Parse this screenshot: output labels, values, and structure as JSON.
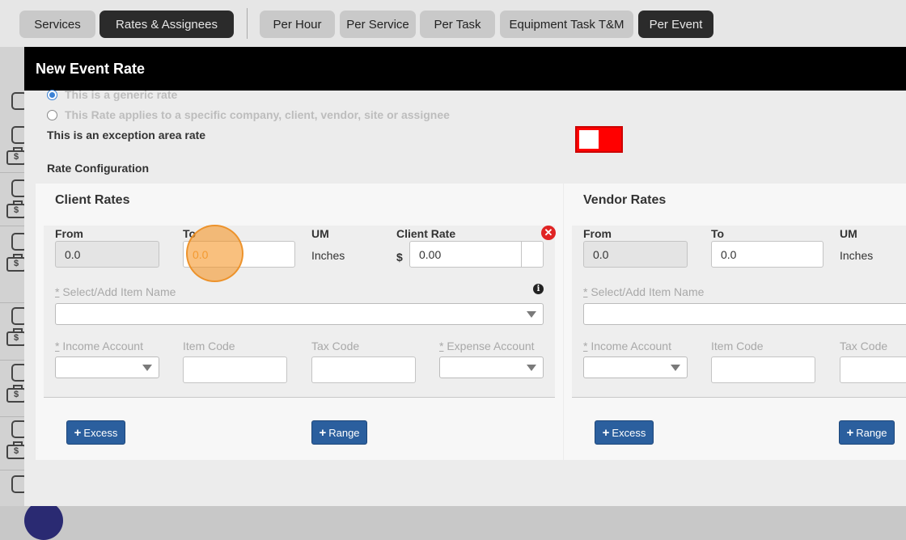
{
  "tabs": [
    {
      "label": "Services",
      "active": false
    },
    {
      "label": "Rates & Assignees",
      "active": true
    },
    {
      "label": "Per Hour",
      "active": false
    },
    {
      "label": "Per Service",
      "active": false
    },
    {
      "label": "Per Task",
      "active": false
    },
    {
      "label": "Equipment Task T&M",
      "active": false
    },
    {
      "label": "Per Event",
      "active": true
    }
  ],
  "modal": {
    "title": "New Event Rate",
    "generic_rate_label": "This is a generic rate",
    "specific_rate_label": "This Rate applies to a specific company, client, vendor, site or assignee",
    "exception_label": "This is an exception area rate",
    "rate_config_label": "Rate Configuration"
  },
  "client": {
    "title": "Client Rates",
    "from_label": "From",
    "to_label": "To",
    "um_label": "UM",
    "rate_label": "Client Rate",
    "from_value": "0.0",
    "to_value": "0.0",
    "um_value": "Inches",
    "currency": "$",
    "rate_value": "0.00",
    "item_name_label": "Select/Add Item Name",
    "income_account_label": "Income Account",
    "item_code_label": "Item Code",
    "tax_code_label": "Tax Code",
    "expense_account_label": "Expense Account",
    "excess_button": "Excess",
    "range_button": "Range"
  },
  "vendor": {
    "title": "Vendor Rates",
    "from_label": "From",
    "to_label": "To",
    "um_label": "UM",
    "from_value": "0.0",
    "to_value": "0.0",
    "um_value": "Inches",
    "item_name_label": "Select/Add Item Name",
    "income_account_label": "Income Account",
    "item_code_label": "Item Code",
    "tax_code_label": "Tax Code",
    "excess_button": "Excess",
    "range_button": "Range"
  },
  "required_marker": "*",
  "colors": {
    "accent": "#2b5f9e",
    "toggle": "#ff0000",
    "header": "#000000",
    "remove": "#e02424"
  }
}
